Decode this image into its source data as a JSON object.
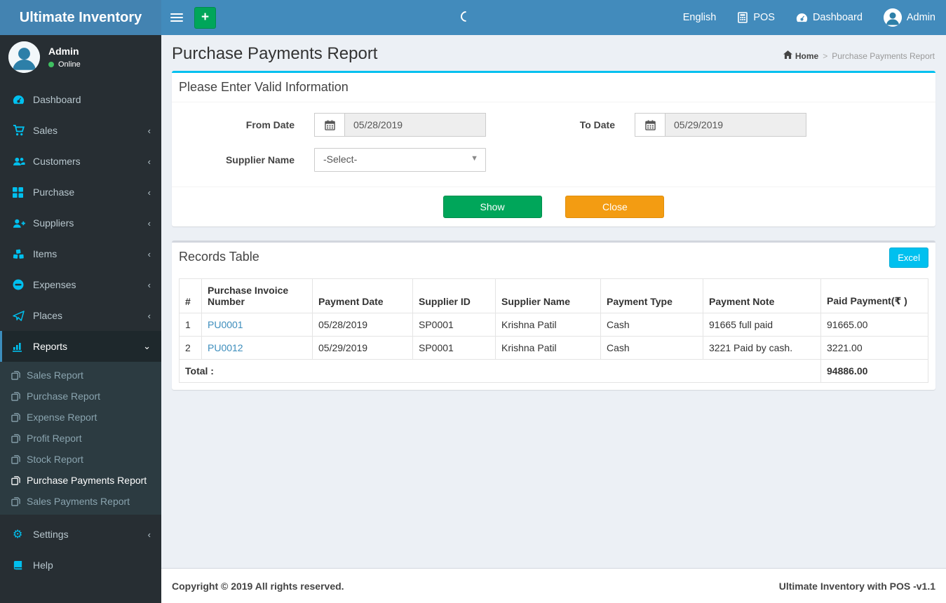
{
  "header": {
    "brand": "Ultimate Inventory",
    "nav": {
      "language": "English",
      "pos": "POS",
      "dashboard": "Dashboard",
      "user": "Admin"
    }
  },
  "sidebar": {
    "user": {
      "name": "Admin",
      "status": "Online"
    },
    "items": [
      {
        "label": "Dashboard",
        "icon": "tachometer-icon",
        "has_children": false
      },
      {
        "label": "Sales",
        "icon": "cart-icon",
        "has_children": true
      },
      {
        "label": "Customers",
        "icon": "users-icon",
        "has_children": true
      },
      {
        "label": "Purchase",
        "icon": "grid-icon",
        "has_children": true
      },
      {
        "label": "Suppliers",
        "icon": "user-plus-icon",
        "has_children": true
      },
      {
        "label": "Items",
        "icon": "cubes-icon",
        "has_children": true
      },
      {
        "label": "Expenses",
        "icon": "minus-circle-icon",
        "has_children": true
      },
      {
        "label": "Places",
        "icon": "paper-plane-icon",
        "has_children": true
      },
      {
        "label": "Reports",
        "icon": "bar-chart-icon",
        "has_children": true,
        "active": true,
        "expanded": true
      },
      {
        "label": "Settings",
        "icon": "gears-icon",
        "has_children": true
      },
      {
        "label": "Help",
        "icon": "book-icon",
        "has_children": false
      }
    ],
    "reports_submenu": [
      {
        "label": "Sales Report"
      },
      {
        "label": "Purchase Report"
      },
      {
        "label": "Expense Report"
      },
      {
        "label": "Profit Report"
      },
      {
        "label": "Stock Report"
      },
      {
        "label": "Purchase Payments Report",
        "active": true
      },
      {
        "label": "Sales Payments Report"
      }
    ],
    "caret_collapsed": "‹",
    "caret_expanded": "⌄"
  },
  "page": {
    "title": "Purchase Payments Report",
    "breadcrumb": {
      "home": "Home",
      "separator": ">",
      "current": "Purchase Payments Report"
    }
  },
  "filter_box": {
    "title": "Please Enter Valid Information",
    "from_date": {
      "label": "From Date",
      "value": "05/28/2019"
    },
    "to_date": {
      "label": "To Date",
      "value": "05/29/2019"
    },
    "supplier": {
      "label": "Supplier Name",
      "value": "-Select-"
    },
    "show_label": "Show",
    "close_label": "Close"
  },
  "records": {
    "title": "Records Table",
    "excel_label": "Excel",
    "columns": [
      "#",
      "Purchase Invoice Number",
      "Payment Date",
      "Supplier ID",
      "Supplier Name",
      "Payment Type",
      "Payment Note",
      "Paid Payment(₹ )"
    ],
    "rows": [
      [
        "1",
        "PU0001",
        "05/28/2019",
        "SP0001",
        "Krishna Patil",
        "Cash",
        "91665 full paid",
        "91665.00"
      ],
      [
        "2",
        "PU0012",
        "05/29/2019",
        "SP0001",
        "Krishna Patil",
        "Cash",
        "3221 Paid by cash.",
        "3221.00"
      ]
    ],
    "total_label": "Total :",
    "total_value": "94886.00"
  },
  "footer": {
    "copyright": "Copyright © 2019 All rights reserved.",
    "version": "Ultimate Inventory with POS -v1.1"
  },
  "colors": {
    "navbar_blue": "#428bbc",
    "logo_blue": "#4383b1",
    "sidebar_dark": "#272e33",
    "submenu_dark": "#2c3b41",
    "active_item_dark": "#1e282c",
    "sidebar_icon_cyan": "#00c0ef",
    "box_accent_cyan": "#00c0ef",
    "show_green": "#00a65a",
    "close_orange": "#f39c12",
    "excel_cyan": "#00c0ef",
    "link_blue": "#3c8dbc",
    "online_green": "#3fbf61",
    "content_bg": "#ecf0f5"
  }
}
